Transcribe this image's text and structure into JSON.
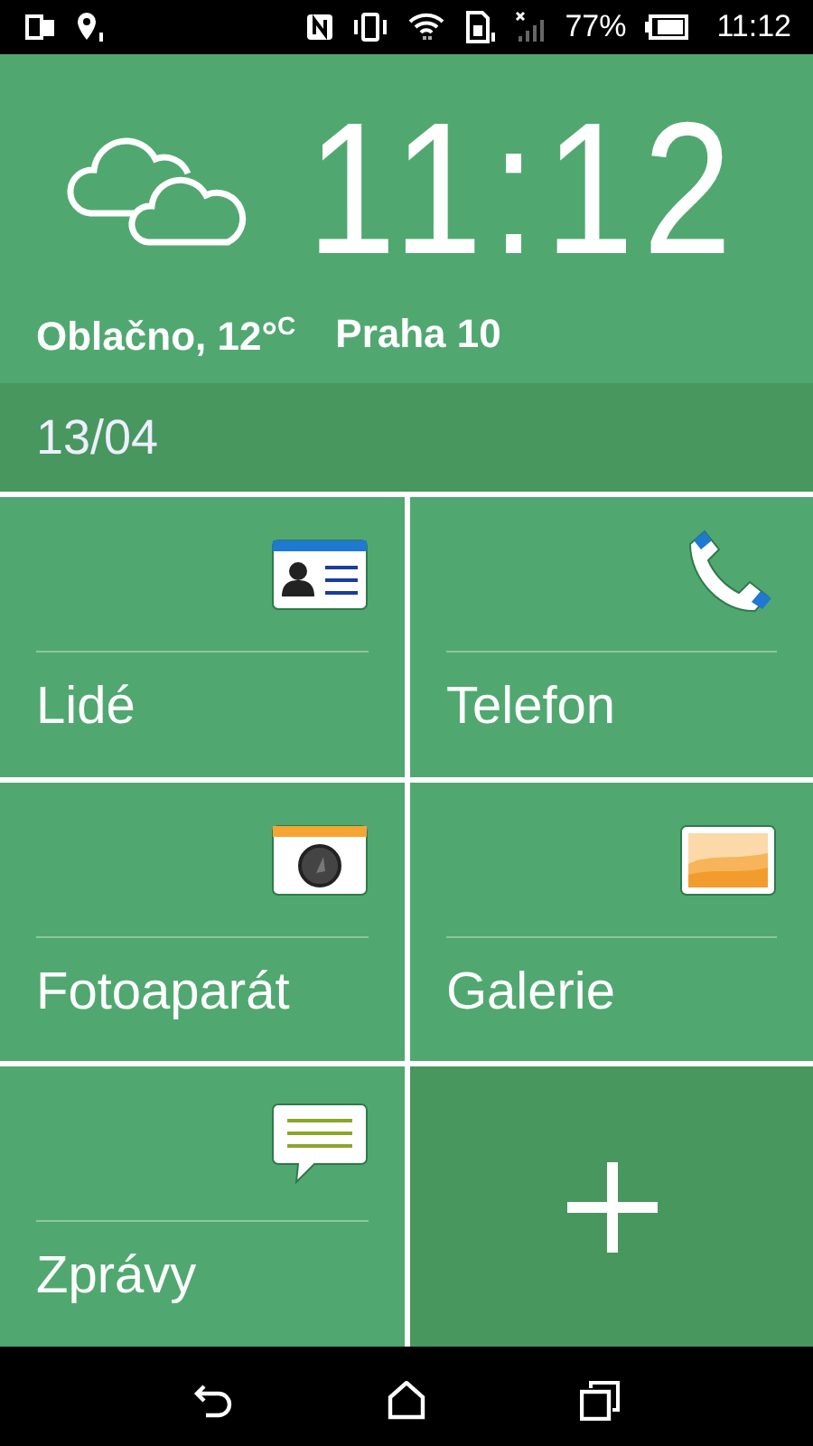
{
  "status_bar": {
    "battery": "77%",
    "time": "11:12"
  },
  "header": {
    "clock": "11:12",
    "weather": "Oblačno, 12°$^{C}$",
    "location": "Praha 10"
  },
  "date": "13/04",
  "tiles": [
    {
      "kind": "contacts",
      "label": "Lidé"
    },
    {
      "kind": "phone",
      "label": "Telefon"
    },
    {
      "kind": "camera",
      "label": "Fotoaparát"
    },
    {
      "kind": "gallery",
      "label": "Galerie"
    },
    {
      "kind": "messages",
      "label": "Zprávy"
    },
    {
      "kind": "add"
    }
  ]
}
